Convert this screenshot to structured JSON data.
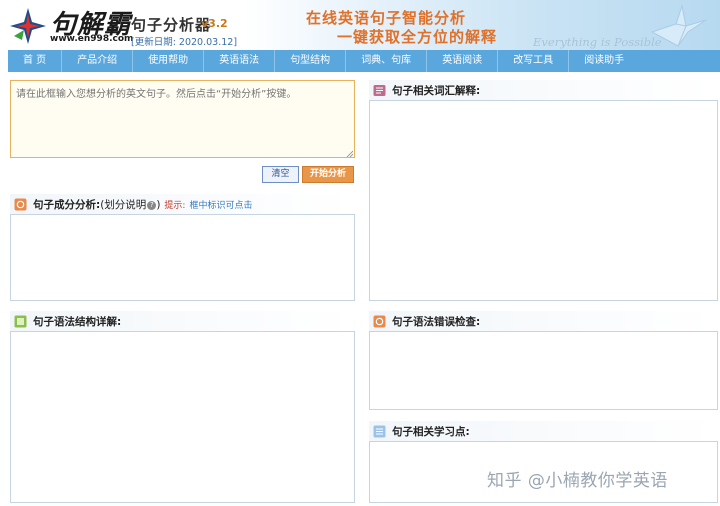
{
  "header": {
    "logo_text": "句解霸",
    "logo_site": "www.en998.com",
    "app_name": "句子分析器",
    "app_version": "v3.2",
    "update_date": "[更新日期: 2020.03.12]",
    "slogan_line1": "在线英语句子智能分析",
    "slogan_line2": "一键获取全方位的解释",
    "tagline": "Everything is Possible"
  },
  "nav": {
    "items": [
      "首 页",
      "产品介绍",
      "使用帮助",
      "英语语法",
      "句型结构",
      "词典、句库",
      "英语阅读",
      "改写工具",
      "阅读助手"
    ]
  },
  "input": {
    "placeholder": "请在此框输入您想分析的英文句子。然后点击“开始分析”按键。"
  },
  "buttons": {
    "clear": "清空",
    "start": "开始分析"
  },
  "panels": {
    "components": {
      "title": "句子成分分析:",
      "note": "(划分说明",
      "note_icon": "?",
      "note_close": ")",
      "hint_label": "提示:",
      "hint_text": "框中标识可点击"
    },
    "vocabulary": {
      "title": "句子相关词汇解释:"
    },
    "structure": {
      "title": "句子语法结构详解:"
    },
    "errors": {
      "title": "句子语法错误检查:"
    },
    "learning": {
      "title": "句子相关学习点:"
    }
  },
  "watermark": "知乎 @小楠教你学英语",
  "colors": {
    "nav_bg": "#5aa7de",
    "accent_orange": "#e8974a",
    "input_border": "#e8b15b",
    "panel_border": "#c7d5e3"
  }
}
